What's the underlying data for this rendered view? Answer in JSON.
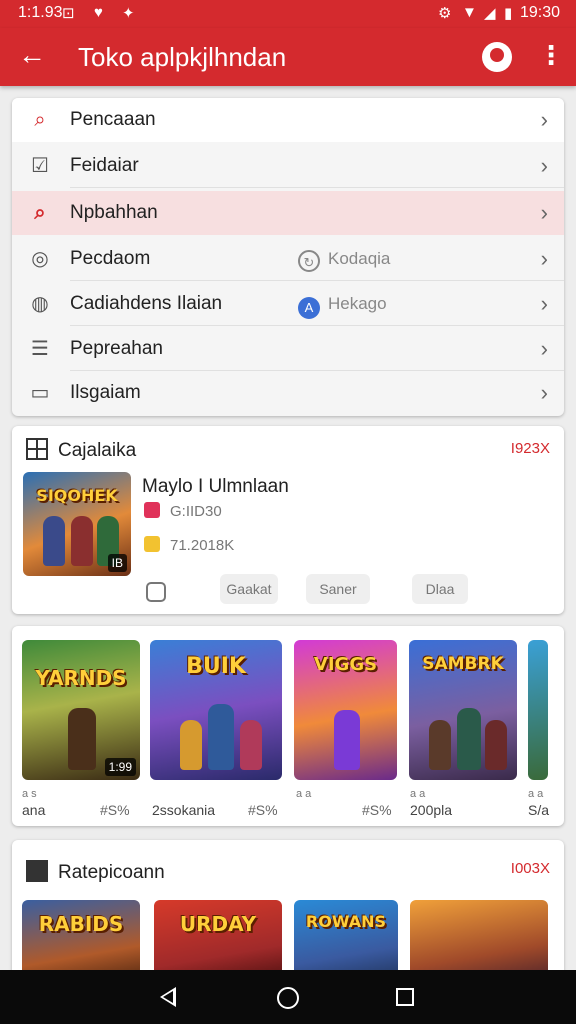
{
  "status_bar": {
    "time": "1:1.93",
    "right_time": "19:30",
    "left_icons": [
      "notification-icon",
      "shield-icon",
      "gift-icon"
    ],
    "right_icons": [
      "alarm-icon",
      "wifi-icon",
      "battery-icon"
    ]
  },
  "app_bar": {
    "title": "Toko aplpkjlhndan"
  },
  "menu": {
    "items": [
      {
        "label": "Pencaaan"
      },
      {
        "label": "Feidaiar"
      },
      {
        "label": "Npbahhan"
      },
      {
        "label": "Pecdaom",
        "sub": "Kodaqia"
      },
      {
        "label": "Cadiahdens Ilaian",
        "sub": "Hekago"
      },
      {
        "label": "Pepreahan"
      },
      {
        "label": "Ilsgaiam"
      }
    ]
  },
  "featured": {
    "heading": "Cajalaika",
    "count": "I923X",
    "thumb_title": "SIQOHEK",
    "thumb_badge": "IB",
    "app_title": "Maylo I Ulmnlaan",
    "meta1": "G:IID30",
    "meta2": "71.2018K",
    "chips": [
      "Gaakat",
      "Saner",
      "Dlaa"
    ]
  },
  "games": {
    "items": [
      {
        "title": "YARNDS",
        "badge": "1:99",
        "cap_left": "ana",
        "cap_right": "#S%",
        "tag_left": "a s",
        "tag_right": ""
      },
      {
        "title": "BUIK",
        "badge": "",
        "cap_left": "2ssokania",
        "cap_right": "#S%",
        "tag_left": "",
        "tag_right": ""
      },
      {
        "title": "VIGGS",
        "badge": "",
        "cap_left": "",
        "cap_right": "#S%",
        "tag_left": "a a",
        "tag_right": ""
      },
      {
        "title": "SAMBRK",
        "badge": "",
        "cap_left": "200pla",
        "cap_right": "",
        "tag_left": "a a",
        "tag_right": ""
      },
      {
        "title": "",
        "badge": "",
        "cap_left": "S/a",
        "cap_right": "",
        "tag_left": "a a",
        "tag_right": ""
      }
    ]
  },
  "recommended": {
    "heading": "Ratepicoann",
    "count": "I003X",
    "items": [
      {
        "title": "RABIDS"
      },
      {
        "title": "URDAY"
      },
      {
        "title": "ROWANS"
      },
      {
        "title": ""
      }
    ]
  },
  "colors": {
    "accent": "#d42a2e",
    "highlight": "#f7dfe0"
  }
}
